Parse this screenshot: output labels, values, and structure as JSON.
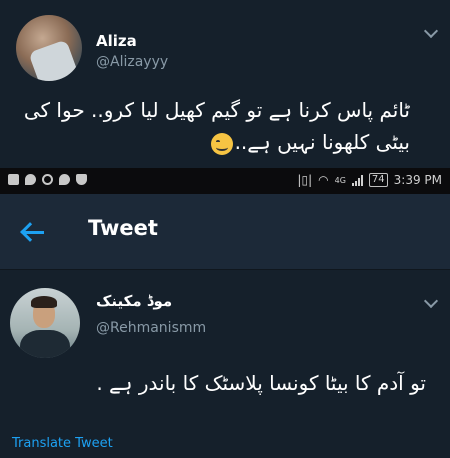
{
  "top_tweet": {
    "name": "Aliza",
    "handle": "@Alizayyy",
    "text": "ٹائم پاس کرنا ہے تو گیم کھیل لیا کرو.. حوا کی بیٹی کلھونا نہیں ہے.."
  },
  "status_bar": {
    "network": "4G",
    "battery": "74",
    "time": "3:39 PM"
  },
  "header": {
    "title": "Tweet"
  },
  "main_tweet": {
    "name": "موڈ مکینک",
    "handle": "@Rehmanismm",
    "text": "تو آدم کا بیٹا کونسا پلاسٹک کا باندر ہے .",
    "translate_label": "Translate Tweet"
  },
  "colors": {
    "background": "#15202b",
    "header": "#1c2938",
    "accent": "#1da1f2",
    "muted": "#8899a6"
  }
}
